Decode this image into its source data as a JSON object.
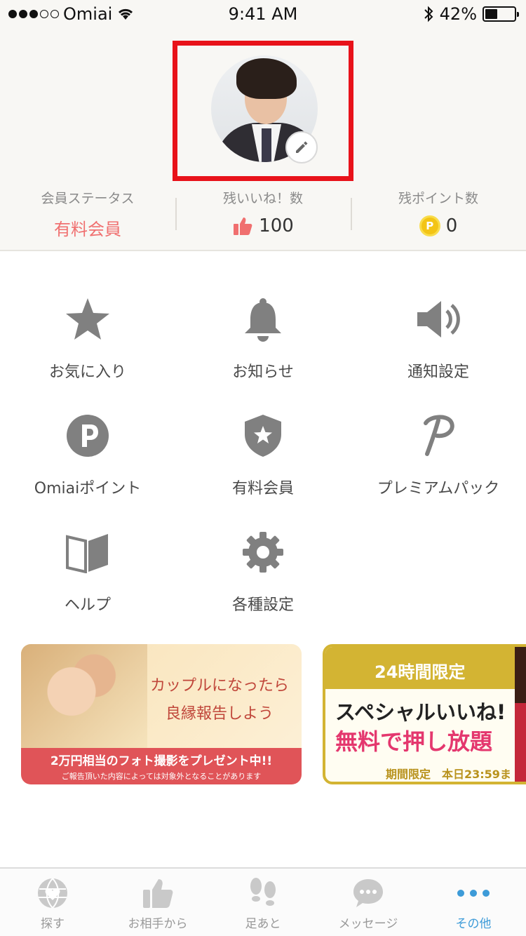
{
  "status_bar": {
    "carrier": "Omiai",
    "time": "9:41 AM",
    "battery": "42%",
    "battery_level": 0.42,
    "signal_bars_filled": 3,
    "signal_bars_total": 5
  },
  "profile": {
    "stats": [
      {
        "label": "会員ステータス",
        "value": "有料会員"
      },
      {
        "label": "残いいね！数",
        "value": "100"
      },
      {
        "label": "残ポイント数",
        "value": "0"
      }
    ],
    "coin_symbol": "P"
  },
  "menu": {
    "items": [
      {
        "label": "お気に入り",
        "icon": "star-icon"
      },
      {
        "label": "お知らせ",
        "icon": "bell-icon"
      },
      {
        "label": "通知設定",
        "icon": "speaker-icon"
      },
      {
        "label": "Omiaiポイント",
        "icon": "point-icon"
      },
      {
        "label": "有料会員",
        "icon": "shield-star-icon"
      },
      {
        "label": "プレミアムパック",
        "icon": "premium-p-icon"
      },
      {
        "label": "ヘルプ",
        "icon": "book-icon"
      },
      {
        "label": "各種設定",
        "icon": "gear-icon"
      }
    ]
  },
  "banners": {
    "first": {
      "headline_line1": "カップルになったら",
      "headline_line2": "良縁報告しよう",
      "strip_line1": "2万円相当のフォト撮影をプレゼント中!!",
      "strip_line2": "ご報告頂いた内容によっては対象外となることがあります"
    },
    "second": {
      "tag": "24時間限定",
      "line1": "スペシャルいいね!",
      "line2": "無料で押し放題",
      "footer": "期間限定　本日23:59ま"
    }
  },
  "tab_bar": {
    "tabs": [
      {
        "label": "探す",
        "icon": "globe-heart-icon"
      },
      {
        "label": "お相手から",
        "icon": "thumbs-up-icon"
      },
      {
        "label": "足あと",
        "icon": "footprints-icon"
      },
      {
        "label": "メッセージ",
        "icon": "chat-bubble-icon"
      },
      {
        "label": "その他",
        "icon": "more-dots-icon"
      }
    ],
    "active_index": 4
  },
  "colors": {
    "accent_red": "#f07070",
    "highlight_box": "#e8121a",
    "icon_gray": "#808080",
    "tab_active": "#3d9bd8"
  }
}
